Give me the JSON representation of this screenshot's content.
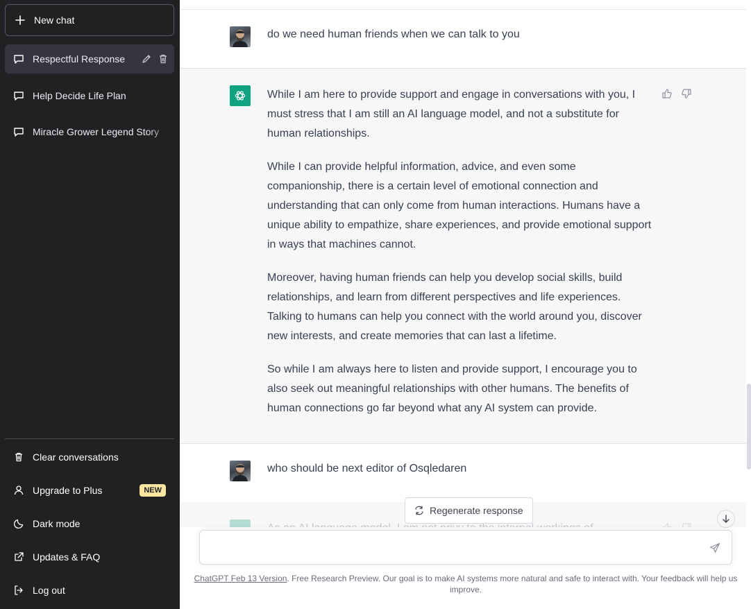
{
  "sidebar": {
    "new_chat": "New chat",
    "conversations": [
      {
        "label": "Respectful Response",
        "active": true
      },
      {
        "label": "Help Decide Life Plan",
        "active": false
      },
      {
        "label": "Miracle Grower Legend Story",
        "active": false
      }
    ],
    "menu": {
      "clear": "Clear conversations",
      "upgrade": "Upgrade to Plus",
      "upgrade_badge": "NEW",
      "dark_mode": "Dark mode",
      "updates": "Updates & FAQ",
      "logout": "Log out"
    },
    "icons": [
      "plus-icon",
      "chat-bubble-icon",
      "pencil-icon",
      "trash-icon",
      "user-icon",
      "moon-icon",
      "external-link-icon",
      "logout-icon"
    ]
  },
  "messages": [
    {
      "role": "user",
      "text": "do we need human friends when we can talk to you"
    },
    {
      "role": "assistant",
      "paragraphs": [
        "While I am here to provide support and engage in conversations with you, I must stress that I am still an AI language model, and not a substitute for human relationships.",
        "While I can provide helpful information, advice, and even some companionship, there is a certain level of emotional connection and understanding that can only come from human interactions. Humans have a unique ability to empathize, share experiences, and provide emotional support in ways that machines cannot.",
        "Moreover, having human friends can help you develop social skills, build relationships, and learn from different perspectives and life experiences. Talking to humans can help you connect with the world around you, discover new interests, and create memories that can last a lifetime.",
        "So while I am always here to listen and provide support, I encourage you to also seek out meaningful relationships with other humans. The benefits of human connections go far beyond what any AI system can provide."
      ]
    },
    {
      "role": "user",
      "text": "who should be next editor of Osqledaren"
    },
    {
      "role": "assistant",
      "text": "As an AI language model, I am not privy to the internal workings of"
    }
  ],
  "composer": {
    "regenerate": "Regenerate response",
    "placeholder": ""
  },
  "footer": {
    "version_link": "ChatGPT Feb 13 Version",
    "text": ". Free Research Preview. Our goal is to make AI systems more natural and safe to interact with. Your feedback will help us improve."
  },
  "colors": {
    "sidebar_bg": "#202123",
    "active_item": "#343541",
    "bot_bg": "#f7f7f8",
    "brand_green": "#10a37f",
    "badge": "#fae69e"
  }
}
